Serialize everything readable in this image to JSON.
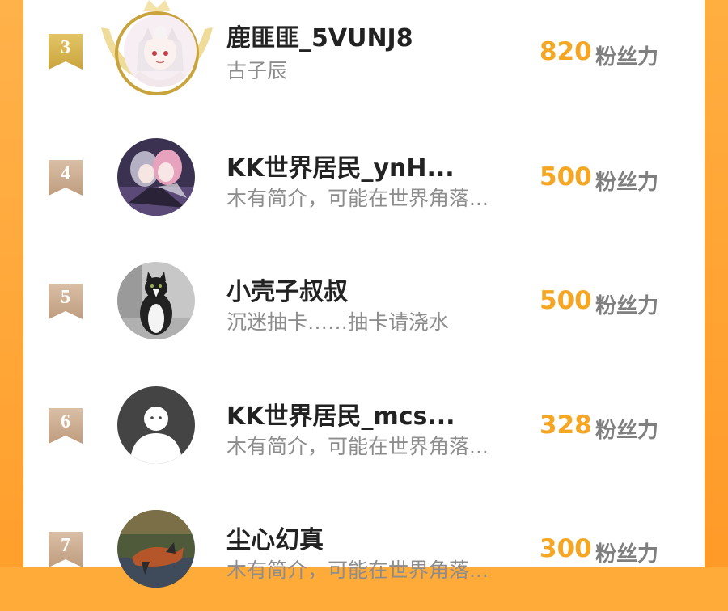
{
  "theme": {
    "score_color": "#f5a623",
    "gold_badge_color": "#d4b24c",
    "tan_badge_color": "#c9a98a",
    "page_edge_color": "#ffab3a"
  },
  "rankings": [
    {
      "rank": "3",
      "name": "鹿匪匪_5VUNJ8",
      "bio": "古子辰",
      "score": "820",
      "unit": "粉丝力",
      "avatar_icon": "anime-character-avatar",
      "frame": "gold-wing-crown-frame"
    },
    {
      "rank": "4",
      "name": "KK世界居民_ynH...",
      "bio": "木有简介，可能在世界角落...",
      "score": "500",
      "unit": "粉丝力",
      "avatar_icon": "anime-duo-avatar"
    },
    {
      "rank": "5",
      "name": "小壳子叔叔",
      "bio": "沉迷抽卡……抽卡请浇水",
      "score": "500",
      "unit": "粉丝力",
      "avatar_icon": "cat-photo-avatar"
    },
    {
      "rank": "6",
      "name": "KK世界居民_mcs...",
      "bio": "木有简介，可能在世界角落...",
      "score": "328",
      "unit": "粉丝力",
      "avatar_icon": "default-user-avatar"
    },
    {
      "rank": "7",
      "name": "尘心幻真",
      "bio": "木有简介，可能在世界角落...",
      "score": "300",
      "unit": "粉丝力",
      "avatar_icon": "fox-photo-avatar"
    }
  ]
}
